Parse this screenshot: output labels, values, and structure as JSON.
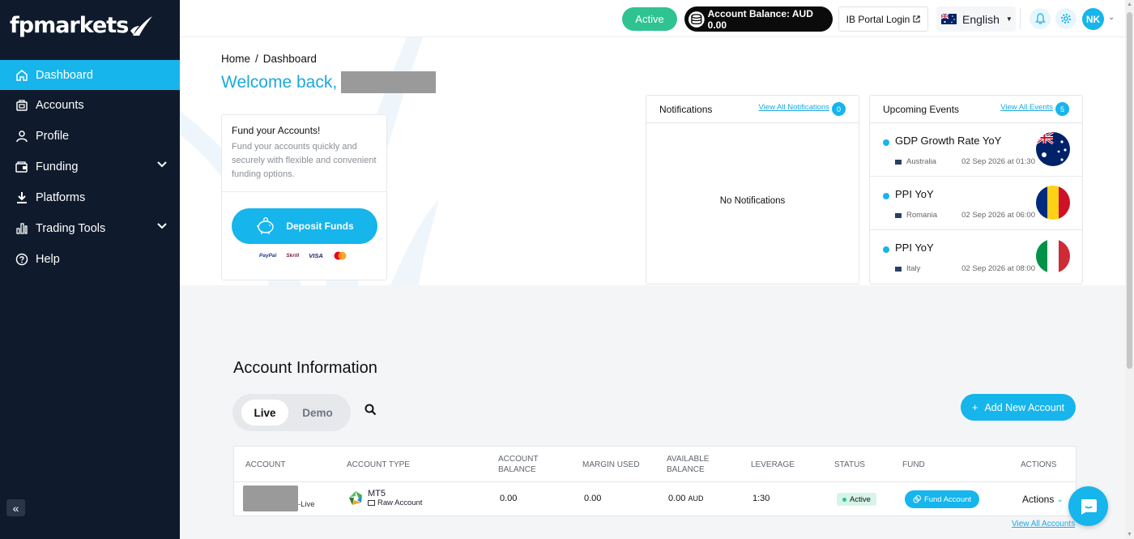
{
  "brand": {
    "name": "fpmarkets"
  },
  "sidebar": {
    "items": [
      {
        "label": "Dashboard",
        "icon": "home-icon",
        "active": true
      },
      {
        "label": "Accounts",
        "icon": "accounts-icon"
      },
      {
        "label": "Profile",
        "icon": "profile-icon"
      },
      {
        "label": "Funding",
        "icon": "funding-icon",
        "expandable": true
      },
      {
        "label": "Platforms",
        "icon": "download-icon"
      },
      {
        "label": "Trading Tools",
        "icon": "chart-bar-icon",
        "expandable": true
      },
      {
        "label": "Help",
        "icon": "help-icon"
      }
    ],
    "collapse_icon": "double-chevron-left-icon"
  },
  "topbar": {
    "status": "Active",
    "balance": "Account Balance: AUD 0.00",
    "ib_portal": "IB Portal Login",
    "language": "English",
    "avatar_initials": "NK"
  },
  "hero": {
    "breadcrumb": {
      "home": "Home",
      "separator": "/",
      "current": "Dashboard"
    },
    "welcome": "Welcome back,"
  },
  "fund_card": {
    "title": "Fund your Accounts!",
    "description": "Fund your accounts quickly and securely with flexible and convenient funding options.",
    "button": "Deposit Funds",
    "payment_logos": [
      "PayPal",
      "Skrill",
      "VISA"
    ]
  },
  "notifications": {
    "title": "Notifications",
    "link": "View All Notifications",
    "count": "0",
    "empty": "No Notifications"
  },
  "events": {
    "title": "Upcoming Events",
    "link": "View All Events",
    "count": "5",
    "items": [
      {
        "name": "GDP Growth Rate YoY",
        "country": "Australia",
        "time": "02 Sep 2026 at 01:30"
      },
      {
        "name": "PPI YoY",
        "country": "Romania",
        "time": "02 Sep 2026 at 06:00"
      },
      {
        "name": "PPI YoY",
        "country": "Italy",
        "time": "02 Sep 2026 at 08:00"
      }
    ]
  },
  "account_info": {
    "title": "Account Information",
    "tabs": [
      "Live",
      "Demo"
    ],
    "add_button": "Add New Account",
    "columns": [
      "ACCOUNT",
      "ACCOUNT TYPE",
      "ACCOUNT\nBALANCE",
      "MARGIN USED",
      "AVAILABLE\nBALANCE",
      "LEVERAGE",
      "STATUS",
      "FUND",
      "ACTIONS"
    ],
    "row": {
      "account_suffix": "-Live",
      "platform": "MT5",
      "type": "Raw Account",
      "balance": "0.00",
      "margin_used": "0.00",
      "available": "0.00",
      "currency": "AUD",
      "leverage": "1:30",
      "status": "Active",
      "fund_button": "Fund Account",
      "actions": "Actions"
    },
    "view_all": "View All Accounts"
  },
  "colors": {
    "accent": "#16b5ec",
    "sidebar": "#0f1b2d",
    "success": "#2fc391"
  }
}
